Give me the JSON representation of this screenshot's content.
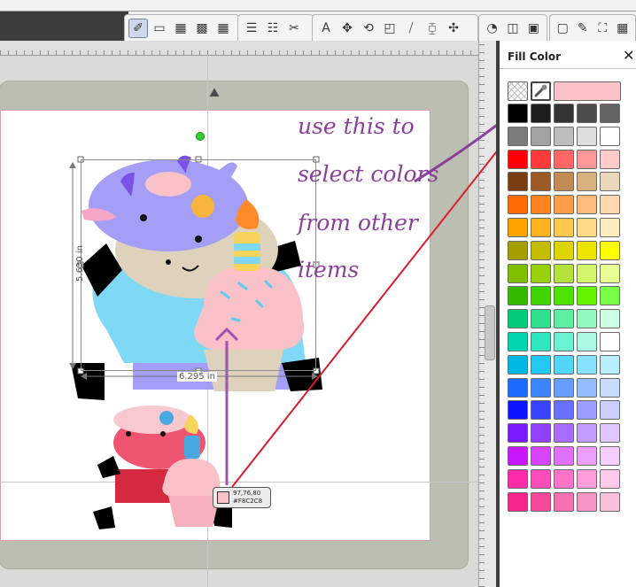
{
  "toolbar": {
    "tools": [
      {
        "icon": "pointer-icon",
        "glyph": "✐",
        "active": true
      },
      {
        "icon": "fill-solid-icon",
        "glyph": "▭"
      },
      {
        "icon": "fill-pattern-icon",
        "glyph": "▦"
      },
      {
        "icon": "fill-hatch-icon",
        "glyph": "▩"
      },
      {
        "icon": "grid-fill-icon",
        "glyph": "▦"
      },
      {
        "icon": "line-color-icon",
        "glyph": "☰"
      },
      {
        "icon": "line-style-icon",
        "glyph": "☷"
      },
      {
        "icon": "scissors-icon",
        "glyph": "✂"
      },
      {
        "icon": "text-icon",
        "glyph": "A"
      },
      {
        "icon": "move-icon",
        "glyph": "✥"
      },
      {
        "icon": "rotate-icon",
        "glyph": "⟲"
      },
      {
        "icon": "scale-icon",
        "glyph": "◰"
      },
      {
        "icon": "skew-icon",
        "glyph": "⧸"
      },
      {
        "icon": "mirror-icon",
        "glyph": "⧮"
      },
      {
        "icon": "distort-icon",
        "glyph": "✣"
      },
      {
        "icon": "trace-icon",
        "glyph": "◔"
      },
      {
        "icon": "align-icon",
        "glyph": "◫"
      },
      {
        "icon": "layer-icon",
        "glyph": "▣"
      },
      {
        "icon": "fill-color-icon",
        "glyph": "▢"
      },
      {
        "icon": "pen-icon",
        "glyph": "✎"
      },
      {
        "icon": "fullscreen-icon",
        "glyph": "⛶"
      },
      {
        "icon": "grid-icon",
        "glyph": "▦"
      }
    ]
  },
  "canvas": {
    "dim_width": "6.295 in",
    "dim_height": "5.630 in",
    "tooltip": {
      "rgb": "97,76,80",
      "hex": "#F8C2C8"
    }
  },
  "annotation": {
    "lines": [
      "use this to",
      "select colors",
      "from other",
      "items"
    ],
    "color": "#8a3f9a"
  },
  "fill_panel": {
    "title": "Fill Color",
    "current_color": "#f8c2c8",
    "palette": [
      [
        "#000000",
        "#1e1e1e",
        "#343434",
        "#4c4c4c",
        "#636363"
      ],
      [
        "#7b7b7b",
        "#a2a2a2",
        "#bdbdbd",
        "#dcdcdc",
        "#ffffff"
      ],
      [
        "#ff0000",
        "#ff3a3a",
        "#ff6666",
        "#ff9898",
        "#ffcaca"
      ],
      [
        "#7a3d12",
        "#9b5a26",
        "#c28a55",
        "#d9b080",
        "#ead6b8"
      ],
      [
        "#ff6a00",
        "#ff8420",
        "#ff9e48",
        "#ffbb7c",
        "#ffd8b0"
      ],
      [
        "#ffa200",
        "#ffb320",
        "#ffc84e",
        "#ffda86",
        "#ffedbe"
      ],
      [
        "#a59e00",
        "#c4bc00",
        "#ddd400",
        "#eee500",
        "#ffff00"
      ],
      [
        "#7fbf00",
        "#98d10a",
        "#b3e23a",
        "#d3f56c",
        "#e8ff94"
      ],
      [
        "#34b800",
        "#3fd400",
        "#4ee400",
        "#63f500",
        "#78ff46"
      ],
      [
        "#00cc7a",
        "#2ee08c",
        "#5eefa2",
        "#92f8bf",
        "#ccffe6"
      ],
      [
        "#00d6b0",
        "#2ee6c0",
        "#6af2d2",
        "#a8f8e4",
        "#ffffff"
      ],
      [
        "#00b8e6",
        "#24c8f0",
        "#54d6f7",
        "#86e2fb",
        "#b8effe"
      ],
      [
        "#1a6cff",
        "#3d84ff",
        "#669fff",
        "#94bcff",
        "#c8dcff"
      ],
      [
        "#0a14ff",
        "#3942ff",
        "#6a70ff",
        "#9c9fff",
        "#cccdff"
      ],
      [
        "#7a18ff",
        "#9240ff",
        "#a86cff",
        "#c39cff",
        "#dec8ff"
      ],
      [
        "#c816ff",
        "#d544ff",
        "#e070ff",
        "#eba0ff",
        "#f5cfff"
      ],
      [
        "#ff2caa",
        "#ff4cb9",
        "#ff74c9",
        "#ff9fd9",
        "#ffc9ea"
      ],
      [
        "#f5248a",
        "#f54a9c",
        "#f570b0",
        "#f696c4",
        "#f8c0d9"
      ]
    ]
  }
}
